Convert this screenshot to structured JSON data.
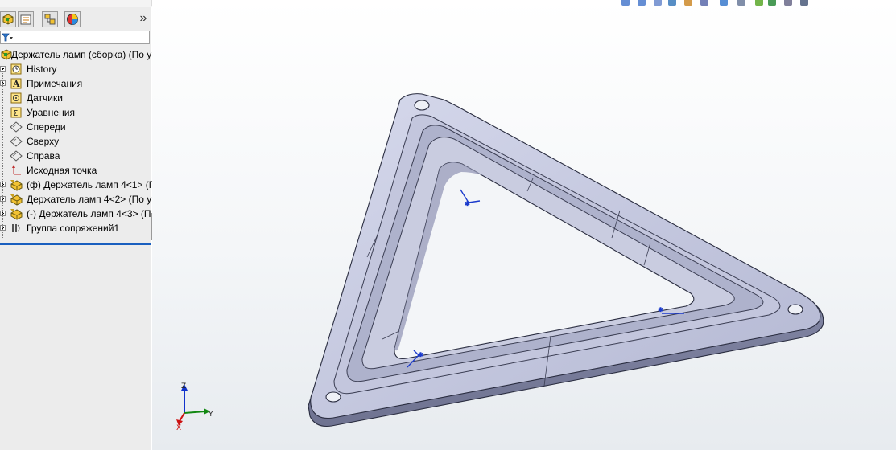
{
  "feature_tree": {
    "root_label": "Держатель ламп (сборка)  (По у",
    "items": [
      {
        "label": "History",
        "icon": "history-icon",
        "expandable": true
      },
      {
        "label": "Примечания",
        "icon": "annotations-icon",
        "expandable": true
      },
      {
        "label": "Датчики",
        "icon": "sensors-icon",
        "expandable": false
      },
      {
        "label": "Уравнения",
        "icon": "equations-icon",
        "expandable": false
      },
      {
        "label": "Спереди",
        "icon": "plane-icon",
        "expandable": false
      },
      {
        "label": "Сверху",
        "icon": "plane-icon",
        "expandable": false
      },
      {
        "label": "Справа",
        "icon": "plane-icon",
        "expandable": false
      },
      {
        "label": "Исходная точка",
        "icon": "origin-icon",
        "expandable": false
      },
      {
        "label": "(ф) Держатель ламп 4<1> (П",
        "icon": "part-icon",
        "expandable": true
      },
      {
        "label": "Держатель ламп 4<2> (По у",
        "icon": "part-icon",
        "expandable": true
      },
      {
        "label": "(-) Держатель ламп 4<3> (П",
        "icon": "part-icon",
        "expandable": true
      },
      {
        "label": "Группа сопряжений1",
        "icon": "mates-icon",
        "expandable": true
      }
    ]
  },
  "panel": {
    "expand_glyph": "»",
    "collapse_glyph": "‹\n‹\n‹"
  },
  "triad": {
    "z": "Z",
    "y": "Y",
    "x": "X"
  },
  "colors": {
    "model": "#bcc0d9",
    "accent": "#1a5fbf",
    "axis_x": "#cc1111",
    "axis_y": "#118811",
    "axis_z": "#1133cc"
  }
}
